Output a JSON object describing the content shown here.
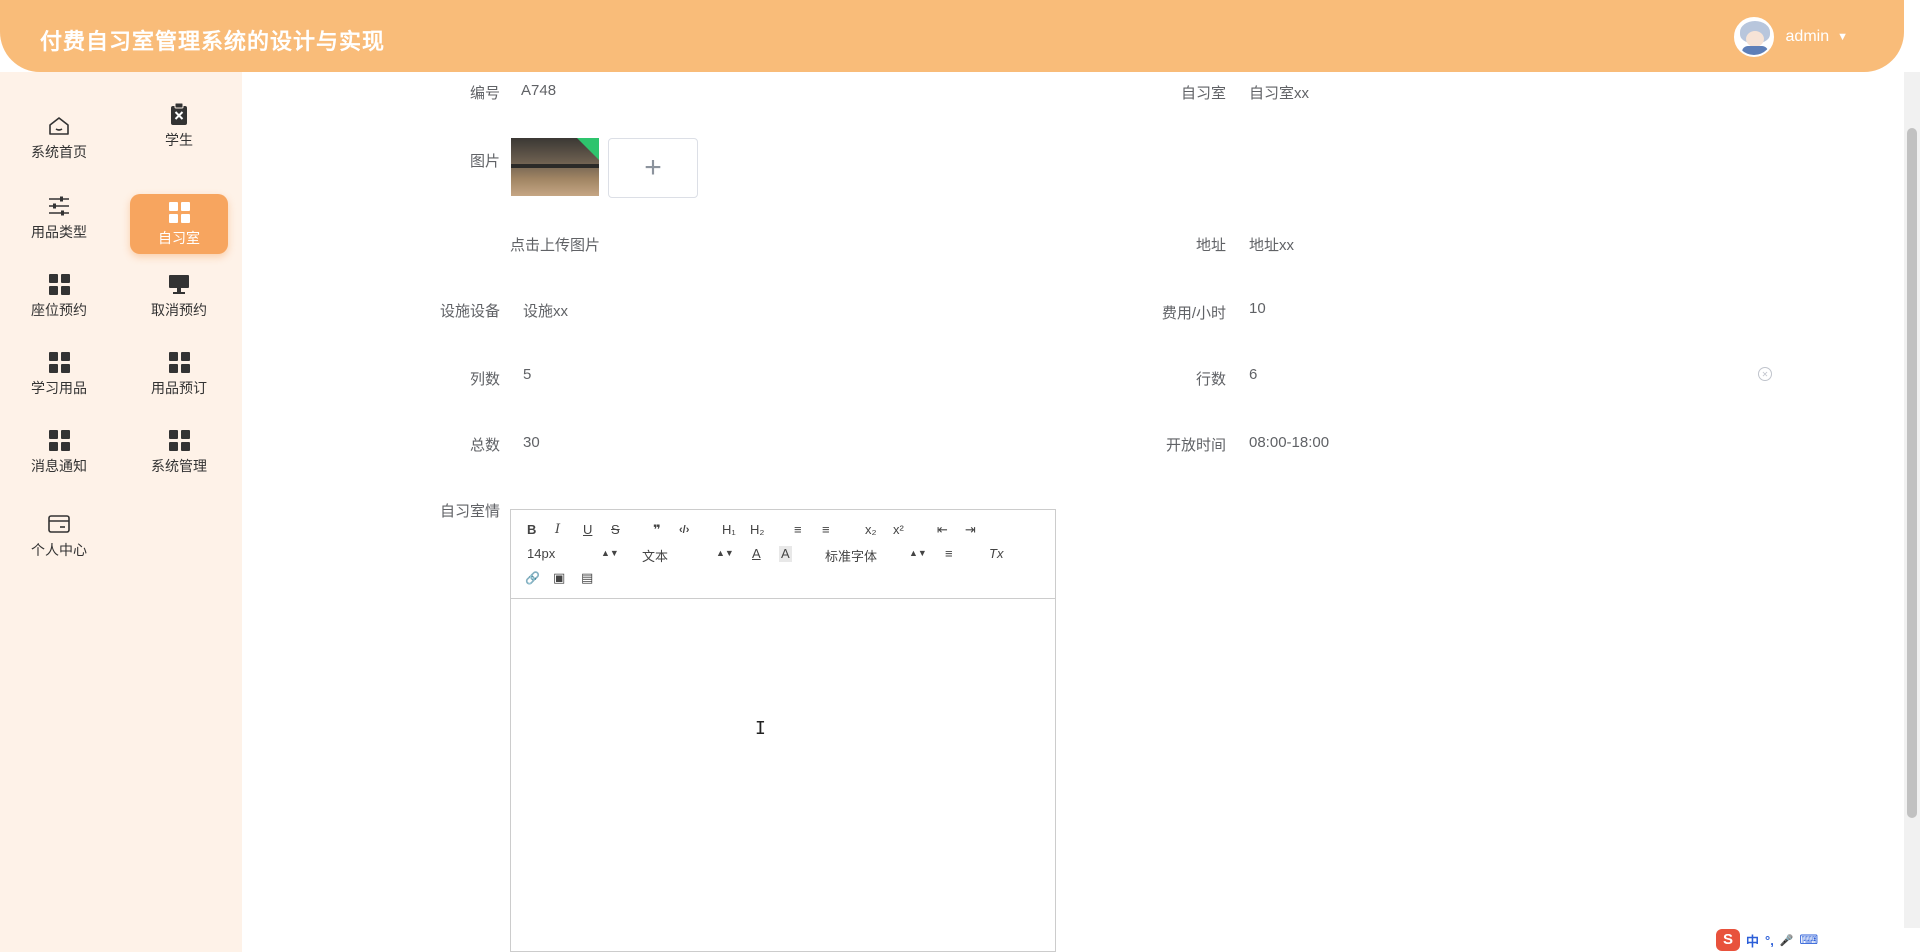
{
  "app": {
    "title": "付费自习室管理系统的设计与实现",
    "user": "admin",
    "caret": "▼"
  },
  "sidebar": {
    "items": [
      {
        "label": "系统首页",
        "icon": "home-icon"
      },
      {
        "label": "学生",
        "icon": "clipboard-x-icon"
      },
      {
        "label": "用品类型",
        "icon": "sliders-icon"
      },
      {
        "label": "自习室",
        "icon": "grid-icon",
        "active": true
      },
      {
        "label": "座位预约",
        "icon": "grid-icon"
      },
      {
        "label": "取消预约",
        "icon": "monitor-icon"
      },
      {
        "label": "学习用品",
        "icon": "grid-icon"
      },
      {
        "label": "用品预订",
        "icon": "grid-icon"
      },
      {
        "label": "消息通知",
        "icon": "grid-icon"
      },
      {
        "label": "系统管理",
        "icon": "grid-icon"
      },
      {
        "label": "个人中心",
        "icon": "card-icon"
      }
    ]
  },
  "form": {
    "code_label": "编号",
    "code_value": "A748",
    "room_label": "自习室",
    "room_value": "自习室xx",
    "image_label": "图片",
    "upload_plus": "+",
    "upload_hint": "点击上传图片",
    "address_label": "地址",
    "address_value": "地址xx",
    "facility_label": "设施设备",
    "facility_value": "设施xx",
    "fee_label": "费用/小时",
    "fee_value": "10",
    "cols_label": "列数",
    "cols_value": "5",
    "rows_label": "行数",
    "rows_value": "6",
    "total_label": "总数",
    "total_value": "30",
    "open_label": "开放时间",
    "open_value": "08:00-18:00",
    "detail_label": "自习室情"
  },
  "editor": {
    "bold": "B",
    "italic": "I",
    "underline": "U",
    "strike": "S",
    "quote": "❞",
    "code": "‹/›",
    "h1": "H₁",
    "h2": "H₂",
    "ol": "≡",
    "ul": "≡",
    "sub": "x₂",
    "sup": "x²",
    "outdent": "⇤",
    "indent": "⇥",
    "size": "14px",
    "header": "文本",
    "font": "标准字体",
    "color": "A",
    "bg": "A",
    "align": "≡",
    "clean": "Tx",
    "link": "🔗",
    "image": "▣",
    "video": "▤"
  },
  "tray": {
    "logo": "S",
    "lang": "中",
    "punct": "°,",
    "mic": "🎤",
    "kbd": "⌨"
  }
}
